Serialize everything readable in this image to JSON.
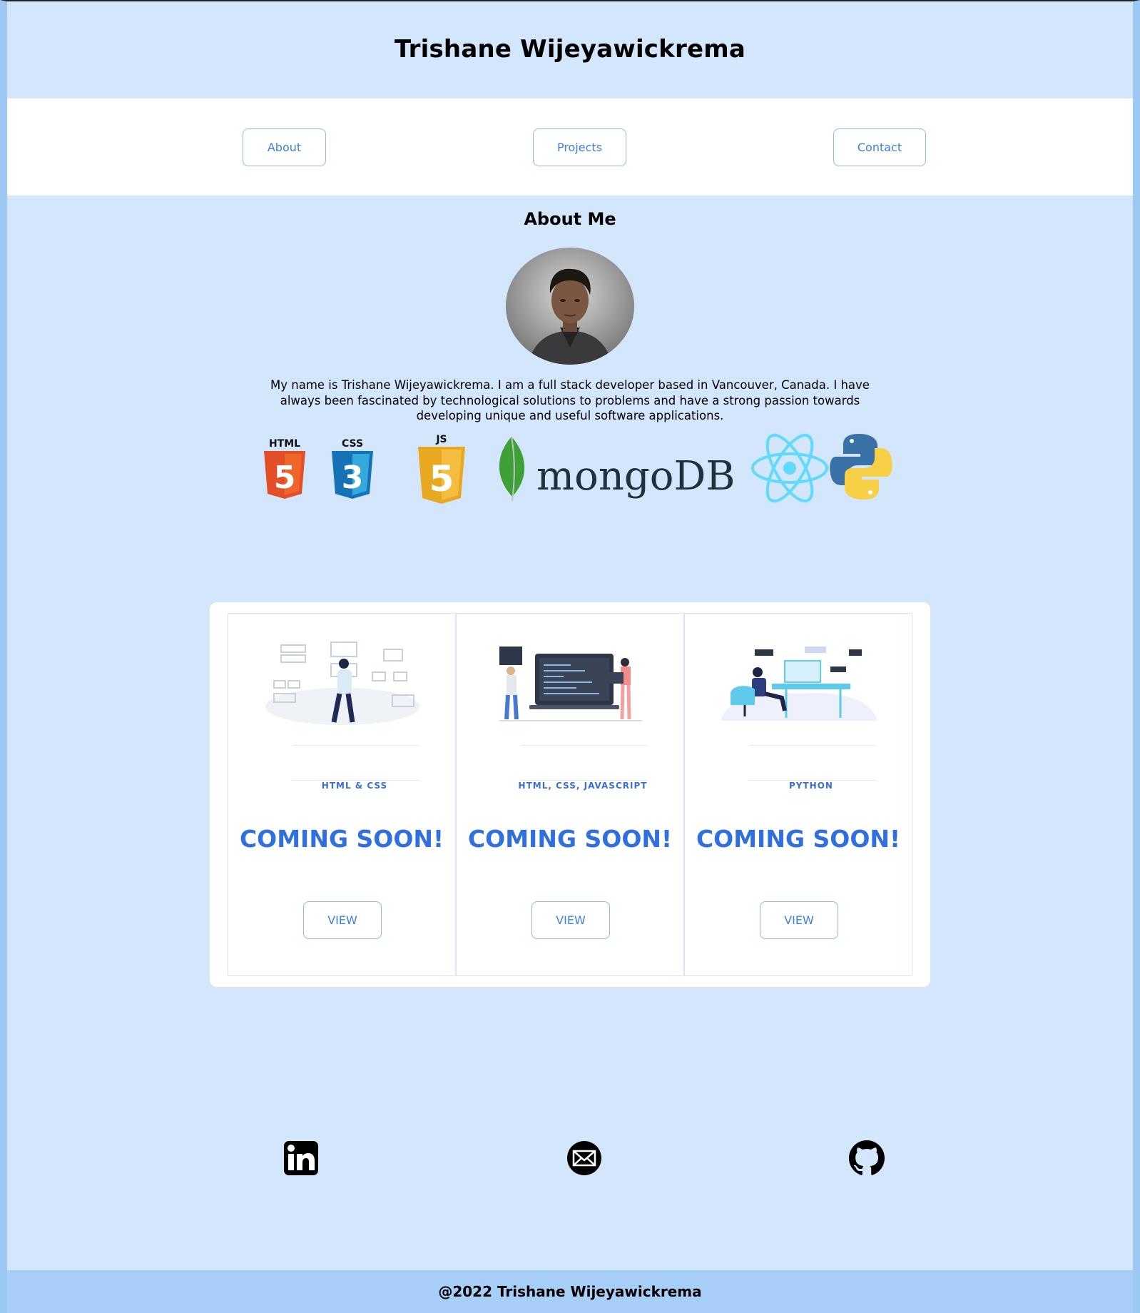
{
  "header": {
    "title": "Trishane Wijeyawickrema"
  },
  "nav": {
    "about": "About",
    "projects": "Projects",
    "contact": "Contact"
  },
  "about": {
    "heading": "About Me",
    "bio": "My name is Trishane Wijeyawickrema. I am a full stack developer based in Vancouver, Canada. I have always been fascinated by technological solutions to problems and have a strong passion towards developing unique and useful software applications.",
    "logos": {
      "html": "HTML",
      "css": "CSS",
      "js": "JS",
      "mongo": "mongoDB"
    }
  },
  "projects": [
    {
      "tag": "HTML & CSS",
      "title": "COMING SOON!",
      "view": "VIEW"
    },
    {
      "tag": "HTML, CSS, JAVASCRIPT",
      "title": "COMING SOON!",
      "view": "VIEW"
    },
    {
      "tag": "PYTHON",
      "title": "COMING SOON!",
      "view": "VIEW"
    }
  ],
  "social": {
    "linkedin": "linkedin-icon",
    "email": "email-icon",
    "github": "github-icon"
  },
  "footer": {
    "text": "@2022 Trishane Wijeyawickrema"
  },
  "colors": {
    "page_bg": "#d3e6fc",
    "accent": "#2f6fe0",
    "footer_bg": "#a6cef7"
  }
}
